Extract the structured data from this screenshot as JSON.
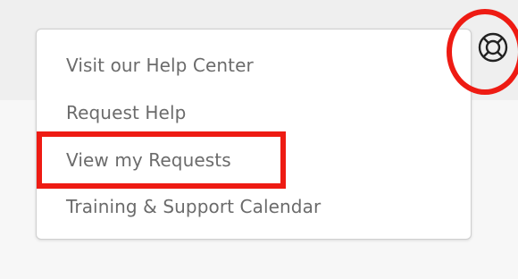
{
  "help_menu": {
    "items": [
      {
        "label": "Visit our Help Center"
      },
      {
        "label": "Request Help"
      },
      {
        "label": "View my Requests"
      },
      {
        "label": "Training & Support Calendar"
      }
    ]
  },
  "icons": {
    "help_button": "lifebuoy-icon"
  },
  "annotations": {
    "highlight_color": "#ee1b13"
  }
}
